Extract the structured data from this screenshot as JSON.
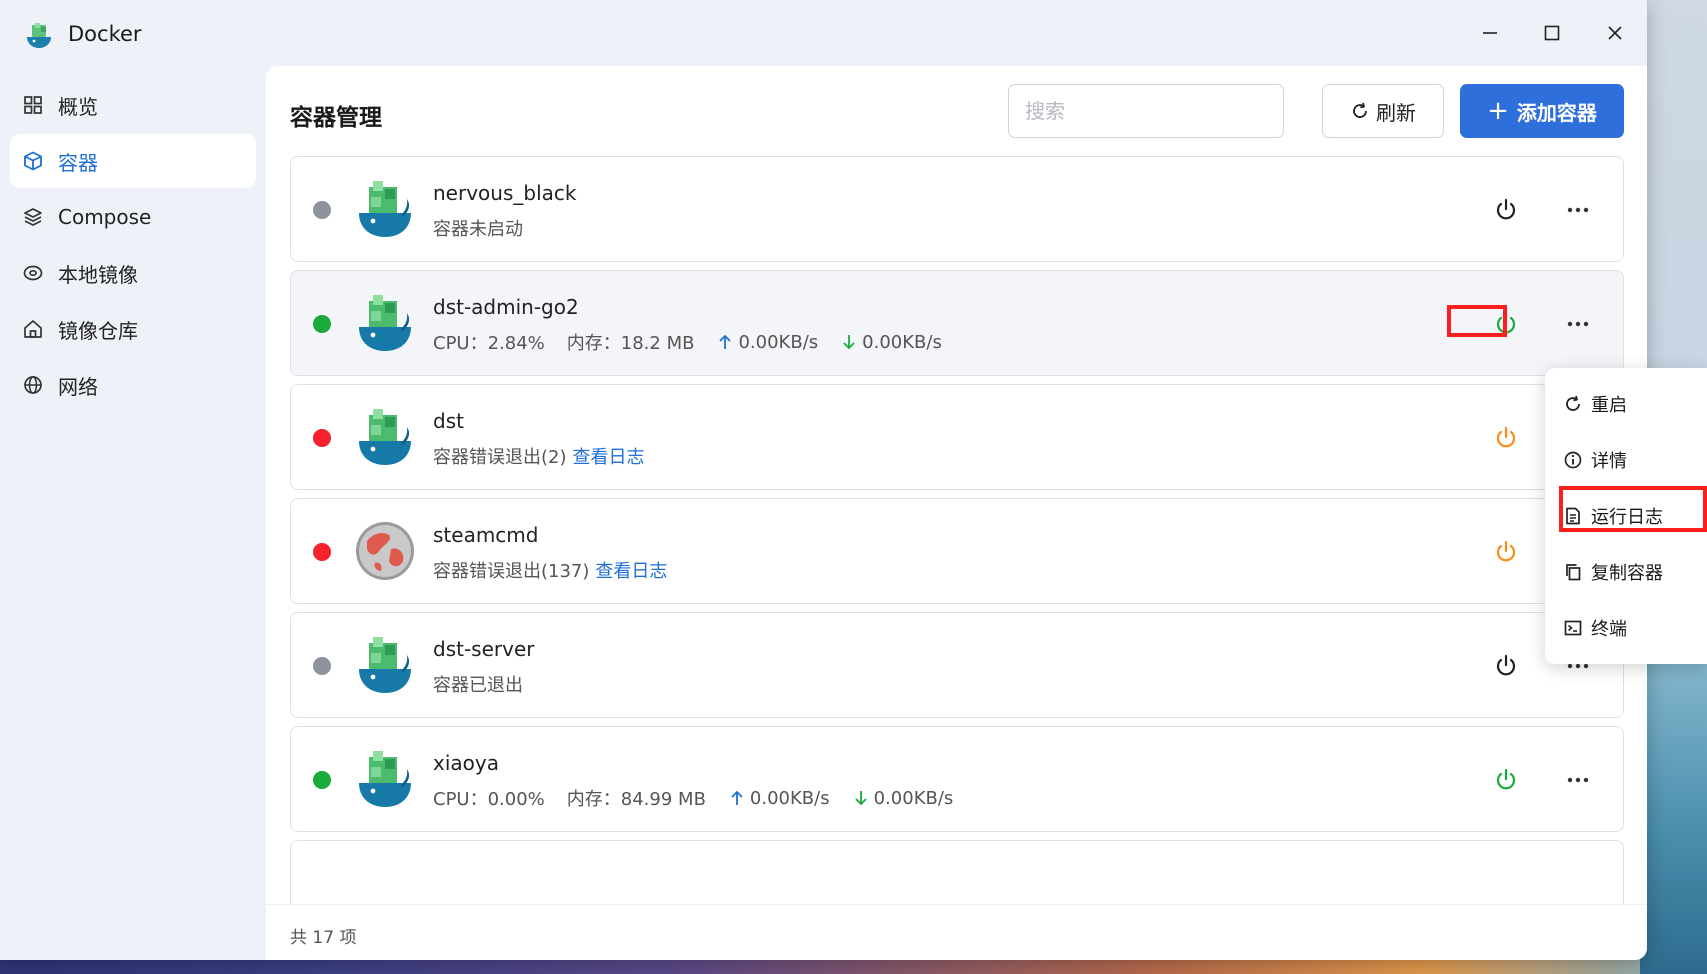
{
  "window": {
    "title": "Docker",
    "controls": [
      "minimize-icon",
      "maximize-icon",
      "close-icon"
    ]
  },
  "sidebar": {
    "items": [
      {
        "label": "概览",
        "icon": "grid-icon",
        "active": false
      },
      {
        "label": "容器",
        "icon": "cube-icon",
        "active": true
      },
      {
        "label": "Compose",
        "icon": "layers-icon",
        "active": false
      },
      {
        "label": "本地镜像",
        "icon": "disc-icon",
        "active": false
      },
      {
        "label": "镜像仓库",
        "icon": "home-icon",
        "active": false
      },
      {
        "label": "网络",
        "icon": "globe-icon",
        "active": false
      }
    ]
  },
  "header": {
    "title": "容器管理",
    "search_placeholder": "搜索",
    "refresh_label": "刷新",
    "add_label": "添加容器"
  },
  "containers": [
    {
      "name": "nervous_black",
      "status": "stopped",
      "dot_color": "#8e929d",
      "power_color": "#222222",
      "detail": "容器未启动"
    },
    {
      "name": "dst-admin-go2",
      "status": "running",
      "dot_color": "#1aab3a",
      "power_color": "#1aab3a",
      "cpu": "CPU：2.84%",
      "mem": "内存：18.2 MB",
      "up": "0.00KB/s",
      "down": "0.00KB/s"
    },
    {
      "name": "dst",
      "status": "error",
      "dot_color": "#f5222d",
      "power_color": "#fa8c16",
      "detail": "容器错误退出(2)",
      "log_link": "查看日志"
    },
    {
      "name": "steamcmd",
      "status": "error",
      "dot_color": "#f5222d",
      "power_color": "#fa8c16",
      "detail": "容器错误退出(137)",
      "log_link": "查看日志"
    },
    {
      "name": "dst-server",
      "status": "exited",
      "dot_color": "#8e929d",
      "power_color": "#222222",
      "detail": "容器已退出"
    },
    {
      "name": "xiaoya",
      "status": "running",
      "dot_color": "#1aab3a",
      "power_color": "#1aab3a",
      "cpu": "CPU：0.00%",
      "mem": "内存：84.99 MB",
      "up": "0.00KB/s",
      "down": "0.00KB/s"
    }
  ],
  "footer": {
    "total": "共 17 项"
  },
  "context_menu": {
    "items": [
      {
        "label": "重启",
        "icon": "restart-icon"
      },
      {
        "label": "详情",
        "icon": "info-icon"
      },
      {
        "label": "运行日志",
        "icon": "log-file-icon"
      },
      {
        "label": "复制容器",
        "icon": "copy-icon"
      },
      {
        "label": "终端",
        "icon": "terminal-icon"
      }
    ]
  },
  "colors": {
    "accent": "#2f6fdc",
    "link": "#1f6fd6",
    "running": "#1aab3a",
    "error": "#f5222d",
    "warning": "#fa8c16",
    "stopped": "#8e929d",
    "highlight": "#ff1e1e"
  }
}
